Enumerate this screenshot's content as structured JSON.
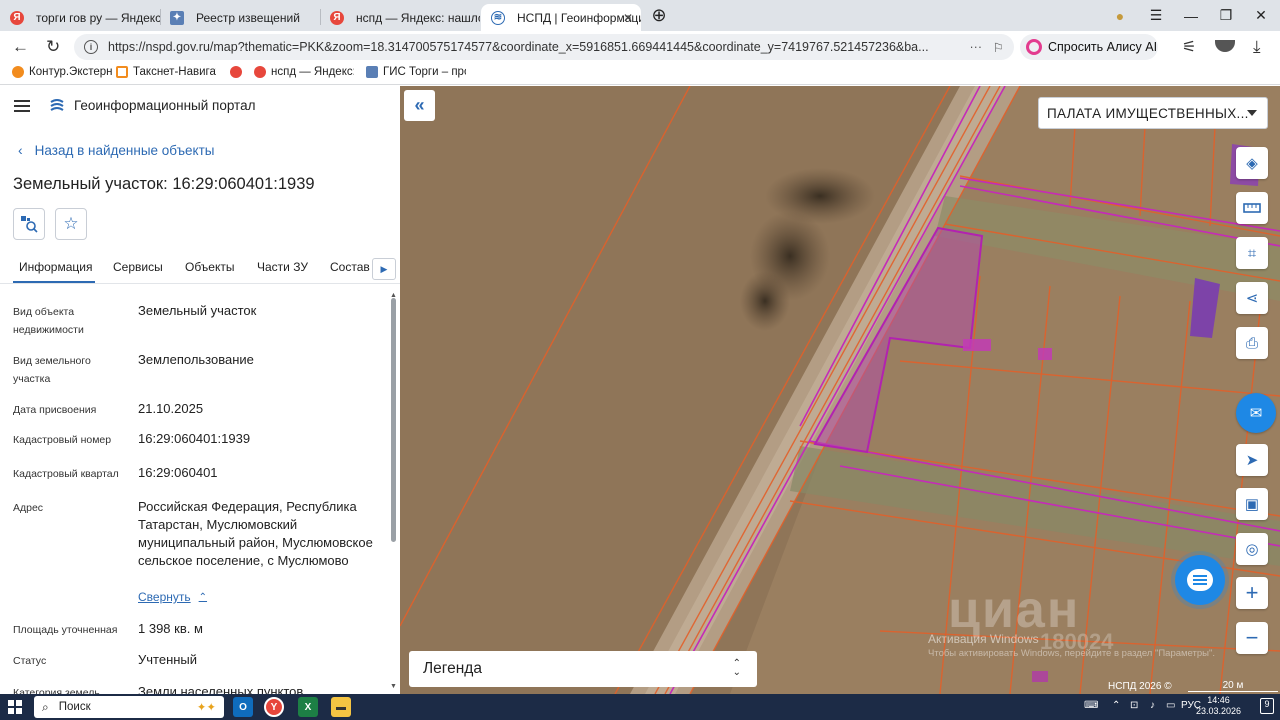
{
  "browser": {
    "tabs": [
      {
        "label": "торги гов ру — Яндекс: на",
        "icon": "yandex-icon"
      },
      {
        "label": "Реестр извещений",
        "icon": "torgi-icon"
      },
      {
        "label": "нспд — Яндекс: нашлось",
        "icon": "yandex-icon"
      },
      {
        "label": "НСПД | Геоинформаци",
        "icon": "nspd-icon",
        "active": true
      }
    ],
    "url": "https://nspd.gov.ru/map?thematic=PKK&zoom=18.314700575174577&coordinate_x=5916851.669441445&coordinate_y=7419767.521457236&ba...",
    "alice_label": "Спросить Алису AI",
    "bookmarks": [
      "Контур.Экстерн",
      "Такснет-Навигато",
      "нспд — Яндекс: на",
      "ГИС Торги – про"
    ]
  },
  "panel": {
    "portal_title": "Геоинформационный портал",
    "back_link": "Назад в найденные объекты",
    "object_title": "Земельный участок: 16:29:060401:1939",
    "tabs": [
      "Информация",
      "Сервисы",
      "Объекты",
      "Части ЗУ",
      "Состав"
    ],
    "fields": [
      {
        "label": "Вид объекта недвижимости",
        "value": "Земельный участок"
      },
      {
        "label": "Вид земельного участка",
        "value": "Землепользование"
      },
      {
        "label": "Дата присвоения",
        "value": "21.10.2025"
      },
      {
        "label": "Кадастровый номер",
        "value": "16:29:060401:1939"
      },
      {
        "label": "Кадастровый квартал",
        "value": "16:29:060401"
      },
      {
        "label": "Адрес",
        "value": "Российская Федерация, Республика Татарстан, Муслюмовский муниципальный район, Муслюмовское сельское поселение, с Муслюмово"
      },
      {
        "label": "Площадь уточненная",
        "value": "1 398 кв. м"
      },
      {
        "label": "Статус",
        "value": "Учтенный"
      },
      {
        "label": "Категория земель",
        "value": "Земли населенных пунктов"
      }
    ],
    "collapse_link": "Свернуть"
  },
  "map": {
    "layer_select": "ПАЛАТА ИМУЩЕСТВЕННЫХ...",
    "legend": "Легенда",
    "copyright": "НСПД 2026 ©",
    "scale": "20 м",
    "watermark_title": "Активация Windows",
    "watermark_sub": "Чтобы активировать Windows, перейдите в раздел \"Параметры\".",
    "cian_mark": "циан",
    "cian_number": "180024"
  },
  "taskbar": {
    "search": "Поиск",
    "lang": "РУС",
    "time": "14:46",
    "date": "23.03.2026",
    "notifications": "9"
  }
}
